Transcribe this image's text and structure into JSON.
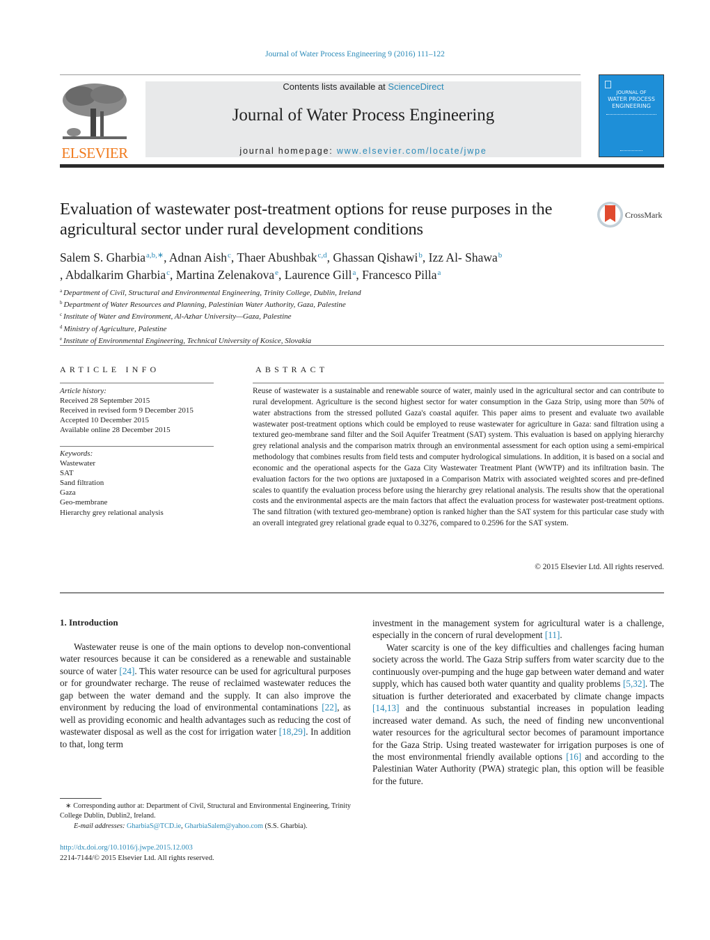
{
  "header": {
    "citation": "Journal of Water Process Engineering 9 (2016) 111–122",
    "contents_prefix": "Contents lists available at ",
    "contents_link": "ScienceDirect",
    "journal_name": "Journal of Water Process Engineering",
    "homepage_prefix": "journal homepage: ",
    "homepage_link": "www.elsevier.com/locate/jwpe",
    "publisher_logo_text": "ELSEVIER",
    "cover": {
      "title_line1": "JOURNAL OF",
      "title_line2": "WATER PROCESS",
      "title_line3": "ENGINEERING",
      "color": "#1e8fd8"
    },
    "crossmark_label": "CrossMark"
  },
  "article": {
    "title": "Evaluation of wastewater post-treatment options for reuse purposes in the agricultural sector under rural development conditions",
    "authors": [
      {
        "name": "Salem S. Gharbia",
        "aff": "a,b,∗",
        "sep": ", "
      },
      {
        "name": "Adnan Aish",
        "aff": "c",
        "sep": ", "
      },
      {
        "name": "Thaer Abushbak",
        "aff": "c,d",
        "sep": ", "
      },
      {
        "name": "Ghassan Qishawi",
        "aff": "b",
        "sep": ", "
      },
      {
        "name": "Izz Al- Shawa",
        "aff": "b",
        "sep": ""
      },
      {
        "name": ", Abdalkarim Gharbia",
        "aff": "c",
        "sep": ", "
      },
      {
        "name": "Martina Zelenakova",
        "aff": "e",
        "sep": ", "
      },
      {
        "name": "Laurence Gill",
        "aff": "a",
        "sep": ", "
      },
      {
        "name": "Francesco Pilla",
        "aff": "a",
        "sep": ""
      }
    ],
    "affiliations": [
      {
        "key": "a",
        "text": "Department of Civil, Structural and Environmental Engineering, Trinity College, Dublin, Ireland"
      },
      {
        "key": "b",
        "text": "Department of Water Resources and Planning, Palestinian Water Authority, Gaza, Palestine"
      },
      {
        "key": "c",
        "text": "Institute of Water and Environment, Al-Azhar University—Gaza, Palestine"
      },
      {
        "key": "d",
        "text": "Ministry of Agriculture, Palestine"
      },
      {
        "key": "e",
        "text": "Institute of Environmental Engineering, Technical University of Kosice, Slovakia"
      }
    ]
  },
  "article_info": {
    "heading": "ARTICLE INFO",
    "history_label": "Article history:",
    "history": [
      "Received 28 September 2015",
      "Received in revised form 9 December 2015",
      "Accepted 10 December 2015",
      "Available online 28 December 2015"
    ],
    "keywords_label": "Keywords:",
    "keywords": [
      "Wastewater",
      "SAT",
      "Sand filtration",
      "Gaza",
      "Geo-membrane",
      "Hierarchy grey relational analysis"
    ]
  },
  "abstract": {
    "heading": "ABSTRACT",
    "text": "Reuse of wastewater is a sustainable and renewable source of water, mainly used in the agricultural sector and can contribute to rural development. Agriculture is the second highest sector for water consumption in the Gaza Strip, using more than 50% of water abstractions from the stressed polluted Gaza's coastal aquifer. This paper aims to present and evaluate two available wastewater post-treatment options which could be employed to reuse wastewater for agriculture in Gaza: sand filtration using a textured geo-membrane sand filter and the Soil Aquifer Treatment (SAT) system. This evaluation is based on applying hierarchy grey relational analysis and the comparison matrix through an environmental assessment for each option using a semi-empirical methodology that combines results from field tests and computer hydrological simulations. In addition, it is based on a social and economic and the operational aspects for the Gaza City Wastewater Treatment Plant (WWTP) and its infiltration basin. The evaluation factors for the two options are juxtaposed in a Comparison Matrix with associated weighted scores and pre-defined scales to quantify the evaluation process before using the hierarchy grey relational analysis. The results show that the operational costs and the environmental aspects are the main factors that affect the evaluation process for wastewater post-treatment options. The sand filtration (with textured geo-membrane) option is ranked higher than the SAT system for this particular case study with an overall integrated grey relational grade equal to 0.3276, compared to 0.2596 for the SAT system.",
    "copyright": "© 2015 Elsevier Ltd. All rights reserved."
  },
  "body": {
    "section_heading": "1.  Introduction",
    "left_para": [
      {
        "t": "Wastewater reuse is one of the main options to develop non-conventional water resources because it can be considered as a renewable and sustainable source of water "
      },
      {
        "ref": "[24]"
      },
      {
        "t": ". This water resource can be used for agricultural purposes or for groundwater recharge. The reuse of reclaimed wastewater reduces the gap between the water demand and the supply. It can also improve the environment by reducing the load of environmental contaminations "
      },
      {
        "ref": "[22]"
      },
      {
        "t": ", as well as providing economic and health advantages such as reducing the cost of wastewater disposal as well as the cost for irrigation water "
      },
      {
        "ref": "[18,29]"
      },
      {
        "t": ". In addition to that, long term"
      }
    ],
    "right_para1": [
      {
        "t": "investment in the management system for agricultural water is a challenge, especially in the concern of rural development "
      },
      {
        "ref": "[11]"
      },
      {
        "t": "."
      }
    ],
    "right_para2": [
      {
        "t": "Water scarcity is one of the key difficulties and challenges facing human society across the world. The Gaza Strip suffers from water scarcity due to the continuously over-pumping and the huge gap between water demand and water supply, which has caused both water quantity and quality problems "
      },
      {
        "ref": "[5,32]"
      },
      {
        "t": ". The situation is further deteriorated and exacerbated by climate change impacts "
      },
      {
        "ref": "[14,13]"
      },
      {
        "t": " and the continuous substantial increases in population leading increased water demand. As such, the need of finding new unconventional water resources for the agricultural sector becomes of paramount importance for the Gaza Strip. Using treated wastewater for irrigation purposes is one of the most environmental friendly available options "
      },
      {
        "ref": "[16]"
      },
      {
        "t": " and according to the Palestinian Water Authority (PWA) strategic plan, this option will be feasible for the future."
      }
    ]
  },
  "footnotes": {
    "corresponding": "∗  Corresponding author at: Department of Civil, Structural and Environmental Engineering, Trinity College Dublin, Dublin2, Ireland.",
    "email_label": "E-mail addresses: ",
    "emails": [
      "GharbiaS@TCD.ie",
      "GharbiaSalem@yahoo.com"
    ],
    "email_suffix": " (S.S. Gharbia).",
    "doi": "http://dx.doi.org/10.1016/j.jwpe.2015.12.003",
    "issn_line": "2214-7144/© 2015 Elsevier Ltd. All rights reserved."
  },
  "colors": {
    "link": "#2a8ab8",
    "elsevier_orange": "#f07a1c",
    "masthead_grey": "#e8e9ea",
    "crossmark_red": "#e04a2e"
  }
}
